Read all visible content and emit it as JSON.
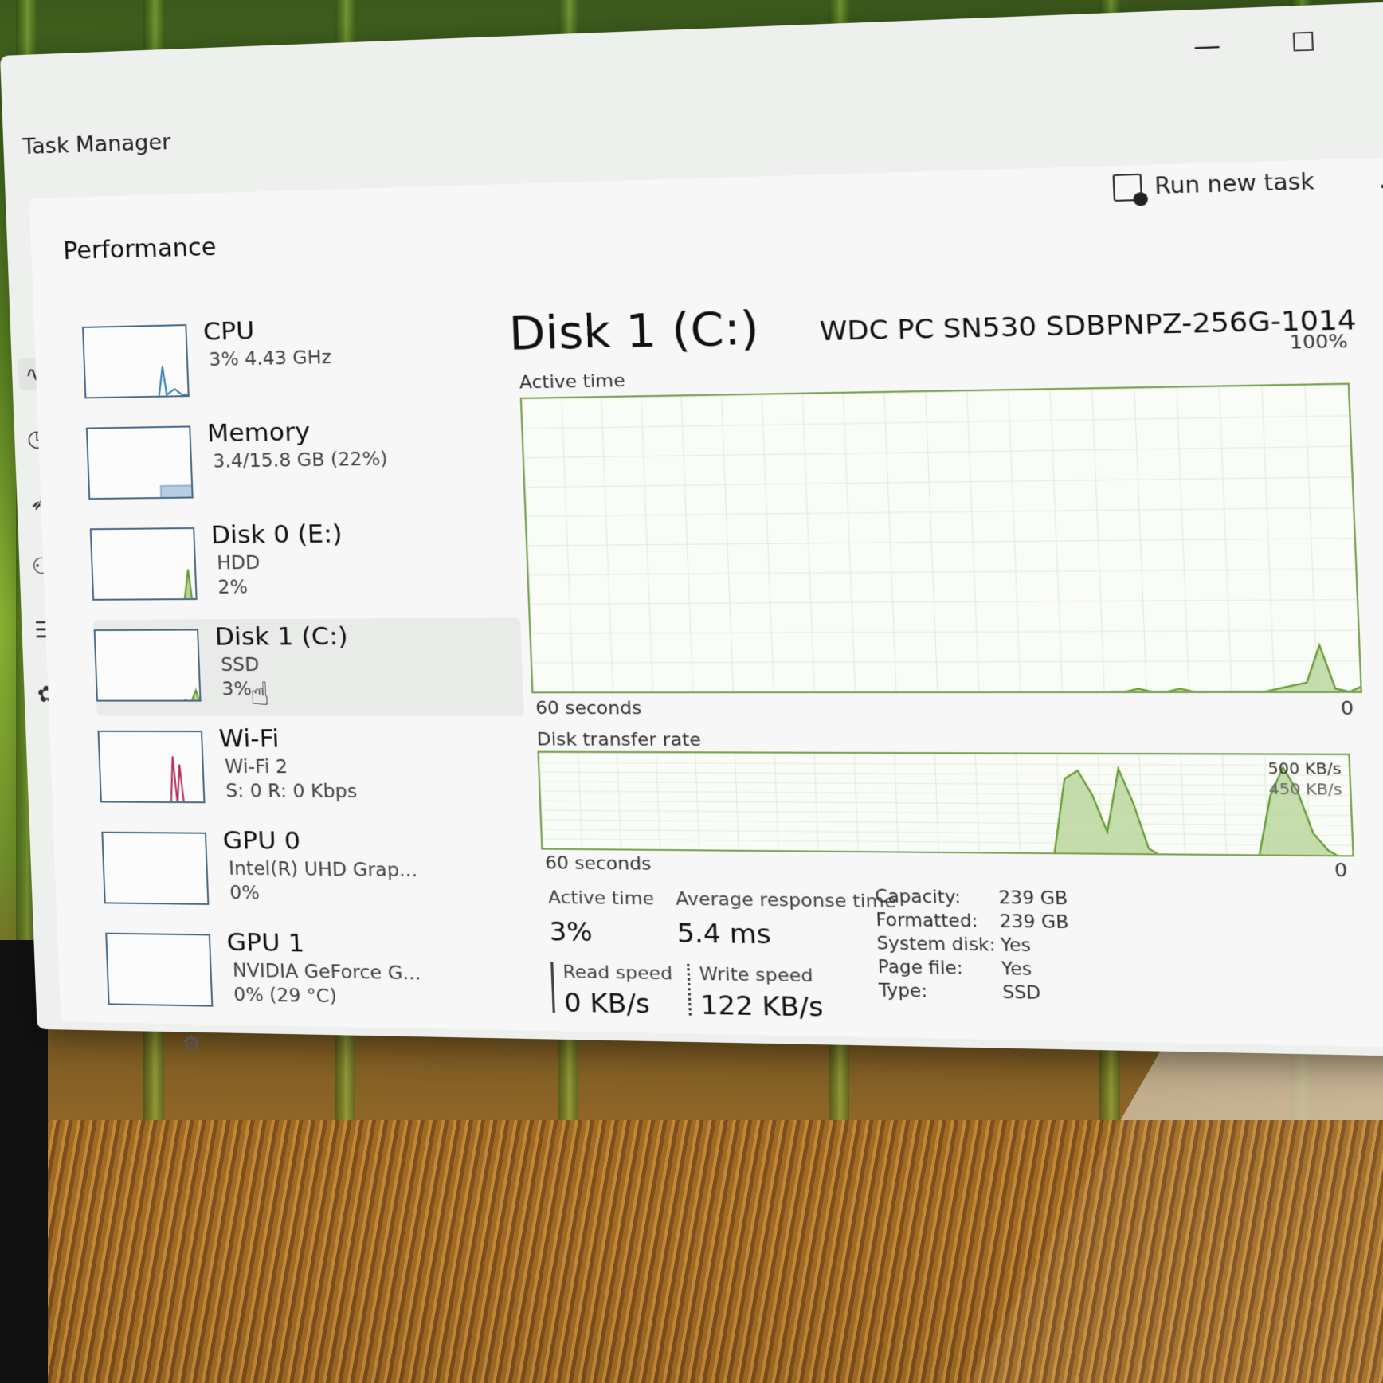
{
  "window": {
    "title": "Task Manager",
    "minimize": "—",
    "maximize": "☐",
    "close": "✕"
  },
  "toolbar": {
    "page_title": "Performance",
    "run_new_task": "Run new task",
    "more": "..."
  },
  "devices": [
    {
      "name": "CPU",
      "sub1": "3% 4.43 GHz",
      "sub2": ""
    },
    {
      "name": "Memory",
      "sub1": "3.4/15.8 GB (22%)",
      "sub2": ""
    },
    {
      "name": "Disk 0 (E:)",
      "sub1": "HDD",
      "sub2": "2%"
    },
    {
      "name": "Disk 1 (C:)",
      "sub1": "SSD",
      "sub2": "3%"
    },
    {
      "name": "Wi-Fi",
      "sub1": "Wi-Fi 2",
      "sub2": "S: 0 R: 0 Kbps"
    },
    {
      "name": "GPU 0",
      "sub1": "Intel(R) UHD Grap...",
      "sub2": "0%"
    },
    {
      "name": "GPU 1",
      "sub1": "NVIDIA GeForce G...",
      "sub2": "0% (29 °C)"
    }
  ],
  "detail": {
    "title": "Disk 1 (C:)",
    "model": "WDC PC SN530 SDBPNPZ-256G-1014",
    "active_graph": {
      "label": "Active time",
      "max": "100%",
      "min": "0",
      "span": "60 seconds"
    },
    "transfer_graph": {
      "label": "Disk transfer rate",
      "max": "500 KB/s",
      "mid": "450 KB/s",
      "min": "0",
      "span": "60 seconds"
    },
    "stats": {
      "active_time_label": "Active time",
      "active_time": "3%",
      "resp_label": "Average response time",
      "resp": "5.4 ms",
      "read_label": "Read speed",
      "read": "0 KB/s",
      "write_label": "Write speed",
      "write": "122 KB/s"
    },
    "props": [
      {
        "k": "Capacity:",
        "v": "239 GB"
      },
      {
        "k": "Formatted:",
        "v": "239 GB"
      },
      {
        "k": "System disk:",
        "v": "Yes"
      },
      {
        "k": "Page file:",
        "v": "Yes"
      },
      {
        "k": "Type:",
        "v": "SSD"
      }
    ]
  },
  "chart_data": [
    {
      "type": "area",
      "title": "Active time",
      "ylim": [
        0,
        100
      ],
      "x_span": "60 seconds",
      "values": [
        0,
        0,
        0,
        0,
        0,
        0,
        0,
        0,
        0,
        0,
        0,
        0,
        0,
        0,
        0,
        0,
        0,
        0,
        0,
        0,
        0,
        0,
        0,
        0,
        0,
        0,
        0,
        0,
        0,
        0,
        0,
        0,
        0,
        0,
        0,
        0,
        0,
        0,
        0,
        0,
        0,
        0,
        0,
        1,
        1,
        2,
        1,
        1,
        2,
        1,
        1,
        1,
        1,
        1,
        1,
        2,
        3,
        4,
        16,
        2,
        1,
        3
      ]
    },
    {
      "type": "area",
      "title": "Disk transfer rate",
      "ylim": [
        0,
        500
      ],
      "x_span": "60 seconds",
      "values": [
        0,
        0,
        0,
        0,
        0,
        0,
        0,
        0,
        0,
        0,
        0,
        0,
        0,
        0,
        0,
        0,
        0,
        0,
        0,
        0,
        0,
        0,
        0,
        0,
        0,
        0,
        0,
        0,
        0,
        0,
        0,
        0,
        0,
        0,
        0,
        0,
        0,
        0,
        0,
        0,
        380,
        420,
        300,
        120,
        430,
        260,
        40,
        0,
        0,
        0,
        0,
        0,
        0,
        0,
        0,
        300,
        440,
        320,
        120,
        40,
        0,
        20
      ]
    }
  ],
  "colors": {
    "disk_line": "#5f9a2b",
    "disk_fill": "#b8d49a",
    "cpu": "#2f7bb0",
    "mem": "#5b8fc2",
    "wifi": "#b22a5a",
    "accent_read": "#444444"
  }
}
